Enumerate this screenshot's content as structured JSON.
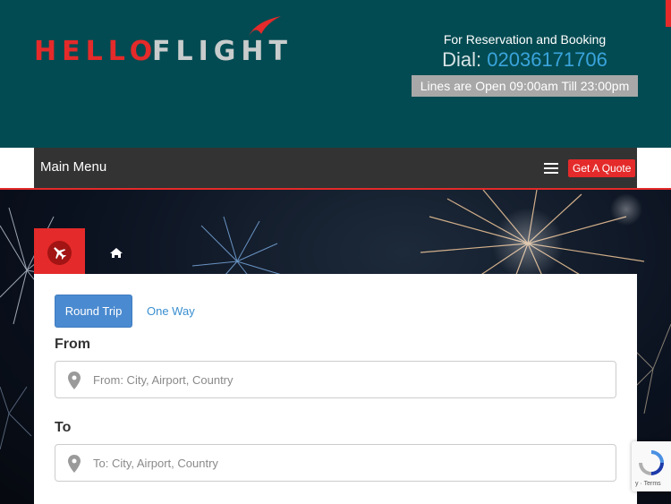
{
  "brand": {
    "word1": "HELLO",
    "word2": "FLIGHT",
    "colors": {
      "red": "#e42a2a",
      "gray": "#c9cccc",
      "teal": "#034b52"
    }
  },
  "contact": {
    "reservation_text": "For Reservation and Booking",
    "dial_label": "Dial:",
    "phone": "02036171706",
    "hours": "Lines are Open 09:00am Till 23:00pm"
  },
  "nav": {
    "menu_label": "Main Menu",
    "quote_button": "Get A Quote"
  },
  "tabs": {
    "flight_icon": "airplane-icon",
    "home_icon": "home-icon"
  },
  "trip_type": {
    "options": [
      "Round Trip",
      "One Way"
    ],
    "selected": "Round Trip"
  },
  "form": {
    "from": {
      "label": "From",
      "placeholder": "From: City, Airport, Country",
      "value": ""
    },
    "to": {
      "label": "To",
      "placeholder": "To: City, Airport, Country",
      "value": ""
    }
  },
  "recaptcha": {
    "terms": "y · Terms"
  }
}
